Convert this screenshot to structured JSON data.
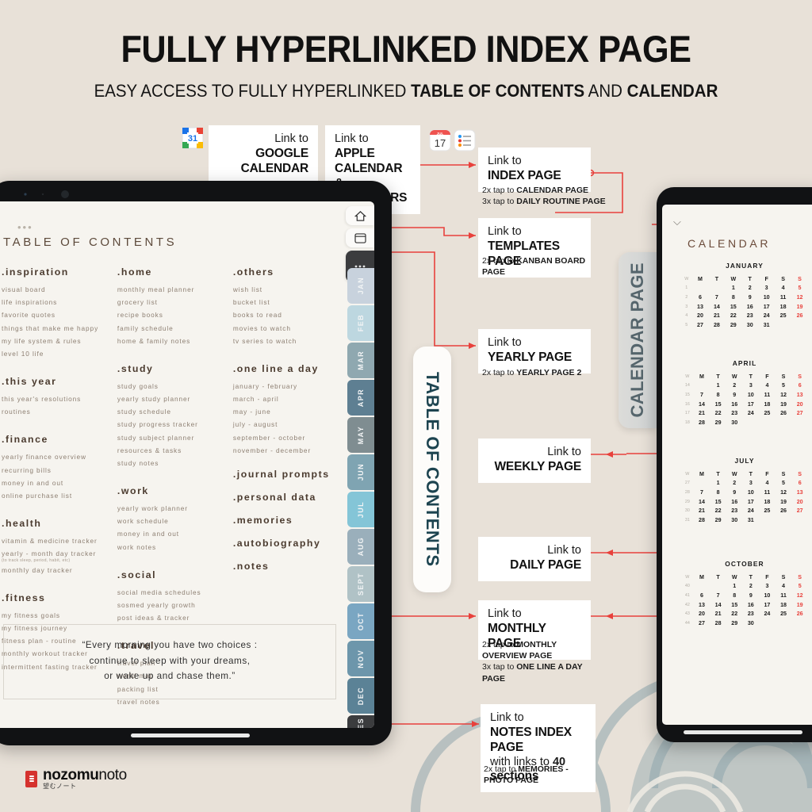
{
  "header": {
    "title": "FULLY HYPERLINKED INDEX PAGE",
    "subtitle_pre": "EASY ACCESS TO FULLY HYPERLINKED ",
    "subtitle_b1": "TABLE OF CONTENTS",
    "subtitle_mid": " AND ",
    "subtitle_b2": "CALENDAR"
  },
  "callouts": {
    "google_calendar": {
      "lt": "Link to",
      "strong": "GOOGLE CALENDAR"
    },
    "apple_calendar": {
      "lt": "Link to",
      "strong": "APPLE CALENDAR",
      "strong2": "& REMINDERS"
    },
    "index_page": {
      "lt": "Link to",
      "strong": "INDEX PAGE"
    },
    "index_note_1_pre": "2x tap to ",
    "index_note_1_b": "CALENDAR PAGE",
    "index_note_2_pre": "3x tap to ",
    "index_note_2_b": "DAILY ROUTINE PAGE",
    "templates_page": {
      "lt": "Link to",
      "strong": "TEMPLATES PAGE"
    },
    "templates_note_pre": "2x tap to ",
    "templates_note_b": "KANBAN BOARD PAGE",
    "yearly_page": {
      "lt": "Link to",
      "strong": "YEARLY PAGE"
    },
    "yearly_note_pre": "2x tap to ",
    "yearly_note_b": "YEARLY PAGE 2",
    "weekly_page": {
      "lt": "Link to",
      "strong": "WEEKLY PAGE"
    },
    "daily_page": {
      "lt": "Link to",
      "strong": "DAILY PAGE"
    },
    "monthly_page": {
      "lt": "Link to",
      "strong": "MONTHLY PAGE"
    },
    "monthly_note_1_pre": "2x tap to ",
    "monthly_note_1_b": "MONTHLY OVERVIEW PAGE",
    "monthly_note_2_pre": "3x tap to ",
    "monthly_note_2_b": "ONE LINE A DAY PAGE",
    "notes_page": {
      "lt": "Link to",
      "strong": "NOTES INDEX PAGE",
      "line3": "with links to ",
      "count": "40",
      "line4": "sections"
    },
    "notes_note_pre": "2x tap to ",
    "notes_note_b": "MEMORIES - PHOTO PAGE"
  },
  "left_tablet": {
    "toc_heading": "TABLE OF CONTENTS",
    "dots": "•••",
    "flap_label": "TABLE OF CONTENTS",
    "quote": [
      "“Every morning you have two choices :",
      "continue to sleep with your dreams,",
      "or wake up and chase them.”"
    ],
    "columns": [
      {
        "sections": [
          {
            "title": ".inspiration",
            "items": [
              "visual board",
              "life inspirations",
              "favorite quotes",
              "things that make me happy",
              "my life system & rules",
              "level 10 life"
            ]
          },
          {
            "title": ".this year",
            "items": [
              "this year's resolutions",
              "routines"
            ]
          },
          {
            "title": ".finance",
            "items": [
              "yearly finance overview",
              "recurring bills",
              "money in and out",
              "online purchase list"
            ]
          },
          {
            "title": ".health",
            "items": [
              "vitamin & medicine tracker",
              "yearly - month day tracker",
              "monthly day tracker"
            ],
            "sub_after": 1,
            "sub": "(to track sleep, period, habit, etc)"
          },
          {
            "title": ".fitness",
            "items": [
              "my fitness goals",
              "my fitness journey",
              "fitness plan - routine",
              "monthly workout tracker",
              "intermittent fasting tracker"
            ]
          }
        ]
      },
      {
        "sections": [
          {
            "title": ".home",
            "items": [
              "monthly meal planner",
              "grocery list",
              "recipe books",
              "family schedule",
              "home & family notes"
            ]
          },
          {
            "title": ".study",
            "items": [
              "study goals",
              "yearly study planner",
              "study schedule",
              "study progress tracker",
              "study subject planner",
              "resources & tasks",
              "study notes"
            ]
          },
          {
            "title": ".work",
            "items": [
              "yearly work planner",
              "work schedule",
              "money in and out",
              "work notes"
            ]
          },
          {
            "title": ".social",
            "items": [
              "social media schedules",
              "sosmed yearly growth",
              "post ideas & tracker"
            ]
          },
          {
            "title": ".travel",
            "items": [
              "travel plan",
              "world map",
              "packing list",
              "travel notes"
            ]
          }
        ]
      },
      {
        "sections": [
          {
            "title": ".others",
            "items": [
              "wish list",
              "bucket list",
              "books to read",
              "movies to watch",
              "tv series to watch"
            ]
          },
          {
            "title": ".one line a day",
            "items": [
              "january - february",
              "march - april",
              "may - june",
              "july - august",
              "september - october",
              "november - december"
            ]
          }
        ],
        "big_items": [
          ".journal prompts",
          ".personal data",
          ".memories",
          ".autobiography",
          ".notes"
        ]
      }
    ],
    "month_tabs": [
      {
        "label": "JAN",
        "color": "#c8d2dd"
      },
      {
        "label": "FEB",
        "color": "#bdd7e0"
      },
      {
        "label": "MAR",
        "color": "#8fa8b0"
      },
      {
        "label": "APR",
        "color": "#5e7f92"
      },
      {
        "label": "MAY",
        "color": "#7f8d91"
      },
      {
        "label": "JUN",
        "color": "#7fa4b2"
      },
      {
        "label": "JUL",
        "color": "#84c5d7"
      },
      {
        "label": "AUG",
        "color": "#9aafbb"
      },
      {
        "label": "SEPT",
        "color": "#b0c2c6"
      },
      {
        "label": "OCT",
        "color": "#7aa6c2"
      },
      {
        "label": "NOV",
        "color": "#6d96ab"
      },
      {
        "label": "DEC",
        "color": "#5b8296"
      },
      {
        "label": "NOTES",
        "color": "#3b3c3e"
      }
    ],
    "icon_tabs": [
      {
        "name": "home-icon",
        "glyph": "⌂"
      },
      {
        "name": "templates-icon",
        "glyph": "▭"
      },
      {
        "name": "more-icon",
        "glyph": "⋯"
      }
    ]
  },
  "right_tablet": {
    "flap_label": "CALENDAR PAGE",
    "back_glyph": "⌵",
    "heading": "CALENDAR",
    "weekday_headers": [
      "W",
      "M",
      "T",
      "W",
      "T",
      "F",
      "S",
      "S"
    ],
    "months": [
      {
        "name": "JANUARY",
        "weeks": [
          {
            "wk": "1",
            "days": [
              "",
              "",
              "1",
              "2",
              "3",
              "4",
              "5"
            ]
          },
          {
            "wk": "2",
            "days": [
              "6",
              "7",
              "8",
              "9",
              "10",
              "11",
              "12"
            ]
          },
          {
            "wk": "3",
            "days": [
              "13",
              "14",
              "15",
              "16",
              "17",
              "18",
              "19"
            ]
          },
          {
            "wk": "4",
            "days": [
              "20",
              "21",
              "22",
              "23",
              "24",
              "25",
              "26"
            ]
          },
          {
            "wk": "5",
            "days": [
              "27",
              "28",
              "29",
              "30",
              "31",
              "",
              ""
            ]
          }
        ]
      },
      {
        "name": "APRIL",
        "weeks": [
          {
            "wk": "14",
            "days": [
              "",
              "1",
              "2",
              "3",
              "4",
              "5",
              "6"
            ]
          },
          {
            "wk": "15",
            "days": [
              "7",
              "8",
              "9",
              "10",
              "11",
              "12",
              "13"
            ]
          },
          {
            "wk": "16",
            "days": [
              "14",
              "15",
              "16",
              "17",
              "18",
              "19",
              "20"
            ]
          },
          {
            "wk": "17",
            "days": [
              "21",
              "22",
              "23",
              "24",
              "25",
              "26",
              "27"
            ]
          },
          {
            "wk": "18",
            "days": [
              "28",
              "29",
              "30",
              "",
              "",
              "",
              ""
            ]
          }
        ]
      },
      {
        "name": "JULY",
        "weeks": [
          {
            "wk": "27",
            "days": [
              "",
              "1",
              "2",
              "3",
              "4",
              "5",
              "6"
            ]
          },
          {
            "wk": "28",
            "days": [
              "7",
              "8",
              "9",
              "10",
              "11",
              "12",
              "13"
            ]
          },
          {
            "wk": "29",
            "days": [
              "14",
              "15",
              "16",
              "17",
              "18",
              "19",
              "20"
            ]
          },
          {
            "wk": "30",
            "days": [
              "21",
              "22",
              "23",
              "24",
              "25",
              "26",
              "27"
            ]
          },
          {
            "wk": "31",
            "days": [
              "28",
              "29",
              "30",
              "31",
              "",
              "",
              ""
            ]
          }
        ]
      },
      {
        "name": "OCTOBER",
        "weeks": [
          {
            "wk": "40",
            "days": [
              "",
              "",
              "1",
              "2",
              "3",
              "4",
              "5"
            ]
          },
          {
            "wk": "41",
            "days": [
              "6",
              "7",
              "8",
              "9",
              "10",
              "11",
              "12"
            ]
          },
          {
            "wk": "42",
            "days": [
              "13",
              "14",
              "15",
              "16",
              "17",
              "18",
              "19"
            ]
          },
          {
            "wk": "43",
            "days": [
              "20",
              "21",
              "22",
              "23",
              "24",
              "25",
              "26"
            ]
          },
          {
            "wk": "44",
            "days": [
              "27",
              "28",
              "29",
              "30",
              "",
              "",
              ""
            ]
          }
        ]
      }
    ]
  },
  "footer": {
    "brand_bold": "nozomu",
    "brand_light": "noto",
    "brand_jp": "望むノート"
  },
  "colors": {
    "background": "#e8e1d8",
    "accent_red": "#e8413c",
    "teal": "#1d4450",
    "paper": "#f6f4ef",
    "device": "#111214",
    "toc_brown": "#4b3b2f"
  }
}
